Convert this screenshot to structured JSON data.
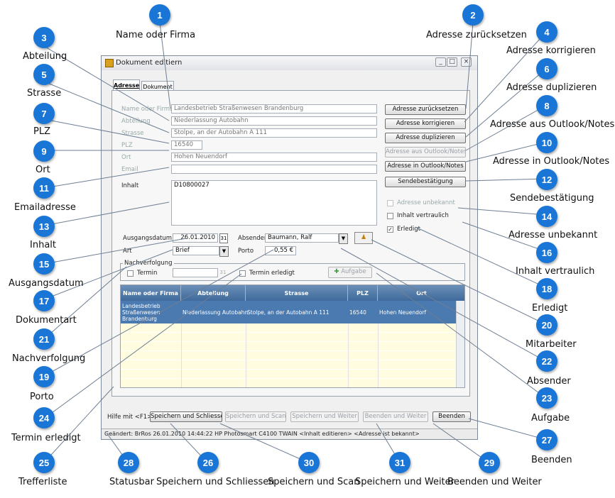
{
  "window": {
    "title": "Dokument editiern",
    "minimize": "_",
    "maximize": "□",
    "close": "×",
    "tabs": [
      "Adresse",
      "Dokument"
    ]
  },
  "form": {
    "name_label": "Name oder Firma",
    "name_value": "Landesbetrieb Straßenwesen Brandenburg",
    "abteilung_label": "Abteilung",
    "abteilung_value": "Niederlassung Autobahn",
    "strasse_label": "Strasse",
    "strasse_value": "Stolpe, an der Autobahn A 111",
    "plz_label": "PLZ",
    "plz_value": "16540",
    "ort_label": "Ort",
    "ort_value": "Hohen Neuendorf",
    "email_label": "Email",
    "email_value": "",
    "inhalt_label": "Inhalt",
    "inhalt_value": "D10800027",
    "ausgangsdatum_label": "Ausgangsdatum",
    "ausgangsdatum_value": "26.01.2010",
    "absender_label": "Absender",
    "absender_value": "Baumann, Ralf",
    "art_label": "Art",
    "art_value": "Brief",
    "porto_label": "Porto",
    "porto_value": "0,55 €",
    "nachverfolgung_label": "Nachverfolgung",
    "termin_label": "Termin",
    "termin_erledigt_label": "Termin erledigt",
    "aufgabe_label": "Aufgabe",
    "adresse_unbekannt_label": "Adresse unbekannt",
    "inhalt_vertraulich_label": "Inhalt vertraulich",
    "erledigt_label": "Erledigt"
  },
  "side_buttons": [
    "Adresse zurücksetzen",
    "Adresse korrigieren",
    "Adresse duplizieren",
    "Adresse aus Outlook/Notes",
    "Adresse in  Outlook/Notes",
    "Sendebestätigung"
  ],
  "table": {
    "headers": [
      "Name oder Firma",
      "Abteilung",
      "Strasse",
      "PLZ",
      "Ort"
    ],
    "rows": [
      [
        "Landesbetrieb Straßenwesen Brandenburg",
        "Niederlassung Autobahn",
        "Stolpe, an der Autobahn A 111",
        "16540",
        "Hohen Neuendorf"
      ]
    ]
  },
  "bottom": {
    "hilfe": "Hilfe mit <F1>",
    "buttons": [
      "Speichern und Schliessen",
      "Speichern und Scan",
      "Speichern und Weiter",
      "Beenden und Weiter",
      "Beenden"
    ],
    "status": "Geändert: BrRos 26.01.2010 14:44:22  HP Photosmart C4100 TWAIN <Inhalt editieren> <Adresse ist bekannt>"
  },
  "callouts": [
    {
      "n": "1",
      "label": "Name oder Firma"
    },
    {
      "n": "2",
      "label": "Adresse zurücksetzen"
    },
    {
      "n": "3",
      "label": "Abteilung"
    },
    {
      "n": "4",
      "label": "Adresse korrigieren"
    },
    {
      "n": "5",
      "label": "Strasse"
    },
    {
      "n": "6",
      "label": "Adresse duplizieren"
    },
    {
      "n": "7",
      "label": "PLZ"
    },
    {
      "n": "8",
      "label": "Adresse aus Outlook/Notes"
    },
    {
      "n": "9",
      "label": "Ort"
    },
    {
      "n": "10",
      "label": "Adresse in  Outlook/Notes"
    },
    {
      "n": "11",
      "label": "Emailadresse"
    },
    {
      "n": "12",
      "label": "Sendebestätigung"
    },
    {
      "n": "13",
      "label": "Inhalt"
    },
    {
      "n": "14",
      "label": "Adresse unbekannt"
    },
    {
      "n": "15",
      "label": "Ausgangsdatum"
    },
    {
      "n": "16",
      "label": "Inhalt vertraulich"
    },
    {
      "n": "17",
      "label": "Dokumentart"
    },
    {
      "n": "18",
      "label": "Erledigt"
    },
    {
      "n": "19",
      "label": "Porto"
    },
    {
      "n": "20",
      "label": "Mitarbeiter"
    },
    {
      "n": "21",
      "label": "Nachverfolgung"
    },
    {
      "n": "22",
      "label": "Absender"
    },
    {
      "n": "23",
      "label": "Aufgabe"
    },
    {
      "n": "24",
      "label": "Termin erledigt"
    },
    {
      "n": "25",
      "label": "Trefferliste"
    },
    {
      "n": "27",
      "label": "Beenden"
    },
    {
      "n": "28",
      "label": "Statusbar"
    },
    {
      "n": "26",
      "label": "Speichern und Schliessen"
    },
    {
      "n": "30",
      "label": "Speichern und Scan"
    },
    {
      "n": "31",
      "label": "Speichern und Weiter"
    },
    {
      "n": "29",
      "label": "Beenden und Weiter"
    }
  ]
}
